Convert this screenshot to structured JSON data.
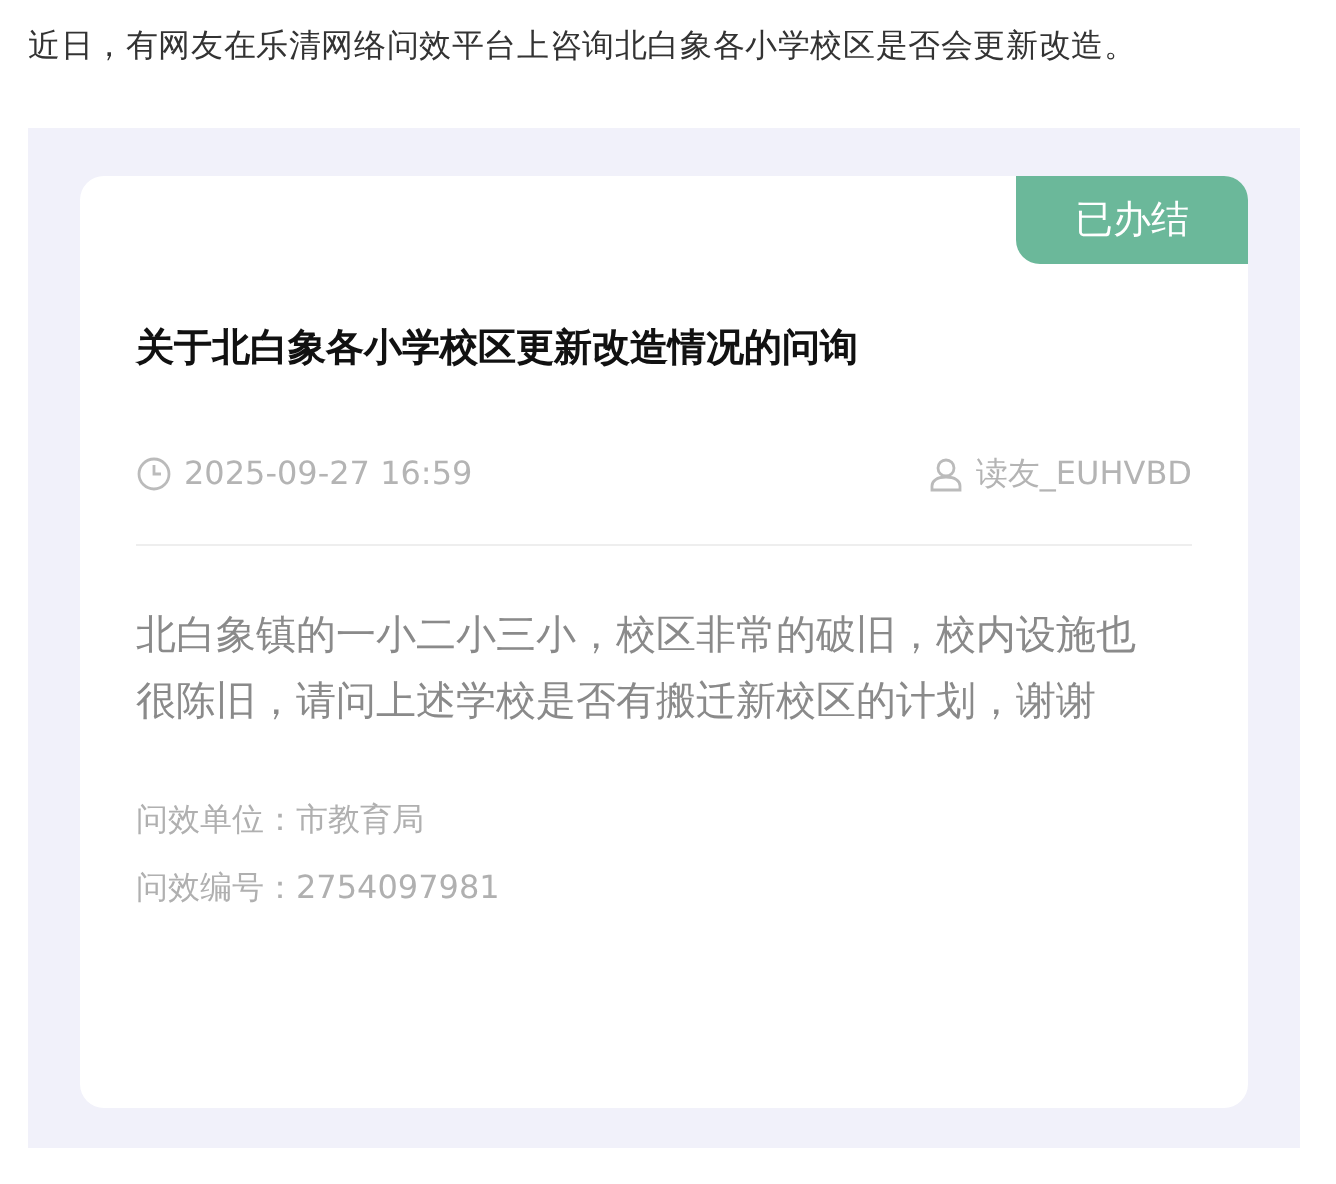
{
  "intro": "近日，有网友在乐清网络问效平台上咨询北白象各小学校区是否会更新改造。",
  "card": {
    "status": "已办结",
    "title": "关于北白象各小学校区更新改造情况的问询",
    "time": "2025-09-27 16:59",
    "author": "读友_EUHVBD",
    "body": "北白象镇的一小二小三小，校区非常的破旧，校内设施也很陈旧，请问上述学校是否有搬迁新校区的计划，谢谢",
    "fields": [
      {
        "label": "问效单位：",
        "value": "市教育局"
      },
      {
        "label": "问效编号：",
        "value": "2754097981"
      }
    ]
  }
}
